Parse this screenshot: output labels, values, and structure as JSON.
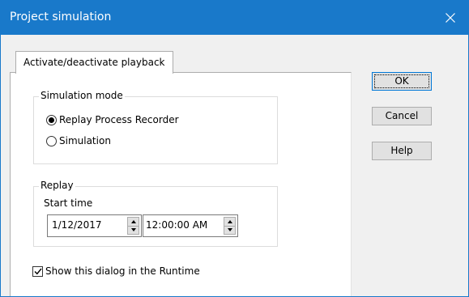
{
  "window": {
    "title": "Project simulation",
    "accent_color": "#1979ca",
    "close_icon": "close-icon"
  },
  "tabs": [
    {
      "label": "Activate/deactivate playback",
      "selected": true
    }
  ],
  "simulation_mode": {
    "group_label": "Simulation mode",
    "options": [
      {
        "label": "Replay Process Recorder",
        "selected": true
      },
      {
        "label": "Simulation",
        "selected": false
      }
    ]
  },
  "replay": {
    "group_label": "Replay",
    "start_time_label": "Start time",
    "date_value": "1/12/2017",
    "time_value": "12:00:00 AM"
  },
  "show_in_runtime": {
    "label": "Show this dialog in the Runtime",
    "checked": true
  },
  "buttons": {
    "ok": "OK",
    "cancel": "Cancel",
    "help": "Help"
  }
}
